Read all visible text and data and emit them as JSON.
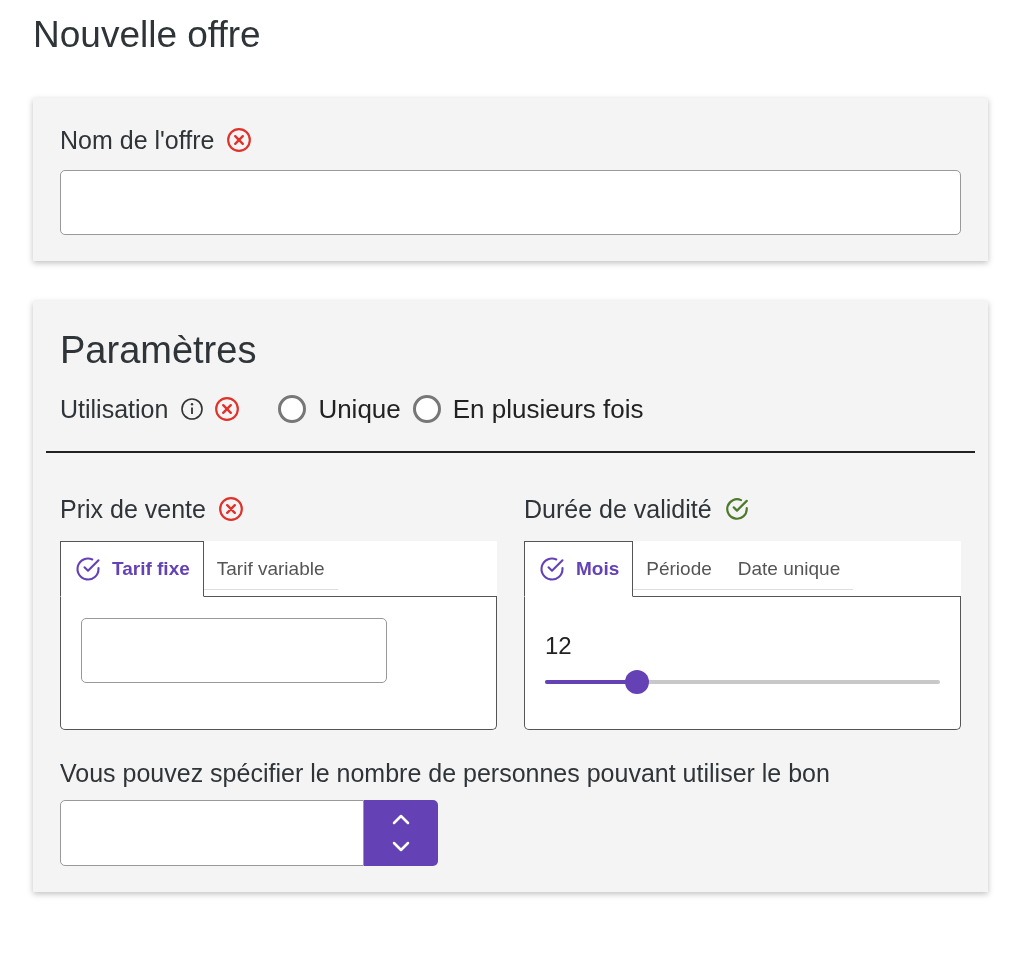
{
  "title": "Nouvelle offre",
  "name_card": {
    "label": "Nom de l'offre",
    "valid": false
  },
  "settings": {
    "title": "Paramètres",
    "usage": {
      "label": "Utilisation",
      "valid": false,
      "options": [
        {
          "label": "Unique",
          "selected": false
        },
        {
          "label": "En plusieurs fois",
          "selected": false
        }
      ]
    },
    "price": {
      "label": "Prix de vente",
      "valid": false,
      "tabs": [
        {
          "label": "Tarif fixe",
          "selected": true
        },
        {
          "label": "Tarif variable",
          "selected": false
        }
      ]
    },
    "duration": {
      "label": "Durée de validité",
      "valid": true,
      "tabs": [
        {
          "label": "Mois",
          "selected": true
        },
        {
          "label": "Période",
          "selected": false
        },
        {
          "label": "Date unique",
          "selected": false
        }
      ],
      "slider": {
        "value": "12",
        "level": 0.233
      }
    },
    "persons": {
      "label": "Vous pouvez spécifier le nombre de personnes pouvant utiliser le bon"
    }
  }
}
